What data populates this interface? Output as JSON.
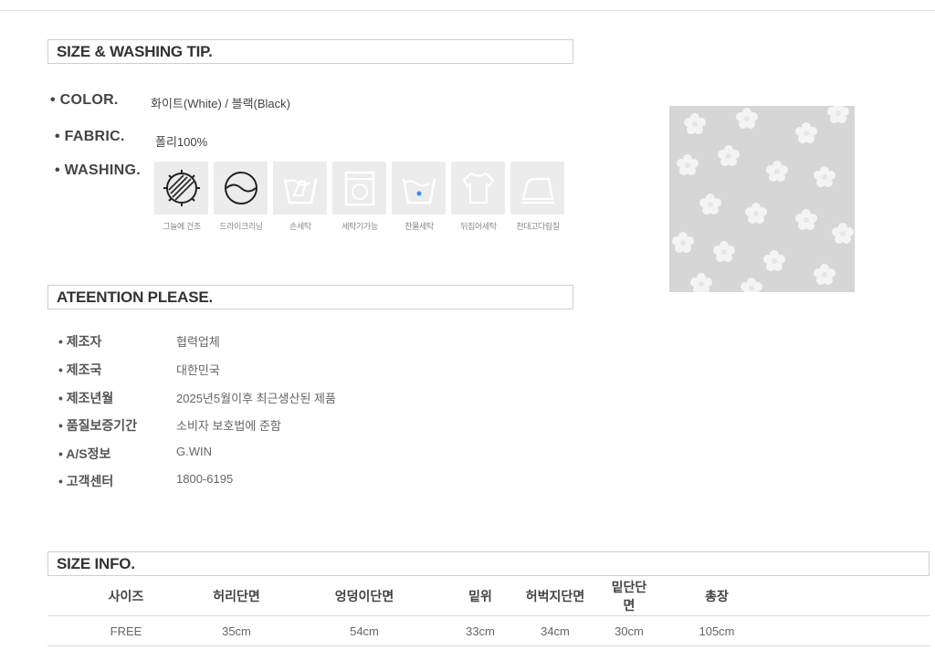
{
  "size_section": {
    "title": "SIZE & WASHING TIP.",
    "color_label": "• COLOR.",
    "color_value": "화이트(White) / 블랙(Black)",
    "fabric_label": "• FABRIC.",
    "fabric_value": "폴리100%",
    "washing_label": "• WASHING.",
    "washing_icons": [
      {
        "icon": "shade-dry-icon",
        "label": "그늘에 건조",
        "active": true
      },
      {
        "icon": "dry-clean-icon",
        "label": "드라이크리닝",
        "active": true
      },
      {
        "icon": "hand-wash-icon",
        "label": "손세탁",
        "active": false
      },
      {
        "icon": "machine-wash-icon",
        "label": "세탁기가능",
        "active": false
      },
      {
        "icon": "cold-wash-icon",
        "label": "찬물세탁",
        "active": false
      },
      {
        "icon": "inside-out-wash-icon",
        "label": "뒤집어세탁",
        "active": false
      },
      {
        "icon": "iron-cloth-icon",
        "label": "천대고다림질",
        "active": false
      }
    ]
  },
  "attention_section": {
    "title": "ATEENTION PLEASE.",
    "rows": [
      {
        "label": "• 제조자",
        "value": "협력업체"
      },
      {
        "label": "• 제조국",
        "value": "대한민국"
      },
      {
        "label": "• 제조년월",
        "value": "2025년5월이후 최근생산된 제품"
      },
      {
        "label": "• 품질보증기간",
        "value": "소비자 보호법에 준함"
      },
      {
        "label": "• A/S정보",
        "value": "G.WIN"
      },
      {
        "label": "• 고객센터",
        "value": "1800-6195"
      }
    ]
  },
  "size_info": {
    "title": "SIZE INFO.",
    "headers": [
      "사이즈",
      "허리단면",
      "엉덩이단면",
      "밑위",
      "허벅지단면",
      "밑단단면",
      "총장"
    ],
    "rows": [
      [
        "FREE",
        "35cm",
        "54cm",
        "33cm",
        "34cm",
        "30cm",
        "105cm"
      ]
    ]
  },
  "colors": {
    "tile_bg": "#ececec",
    "border": "#cfcfcf",
    "text": "#444444"
  }
}
